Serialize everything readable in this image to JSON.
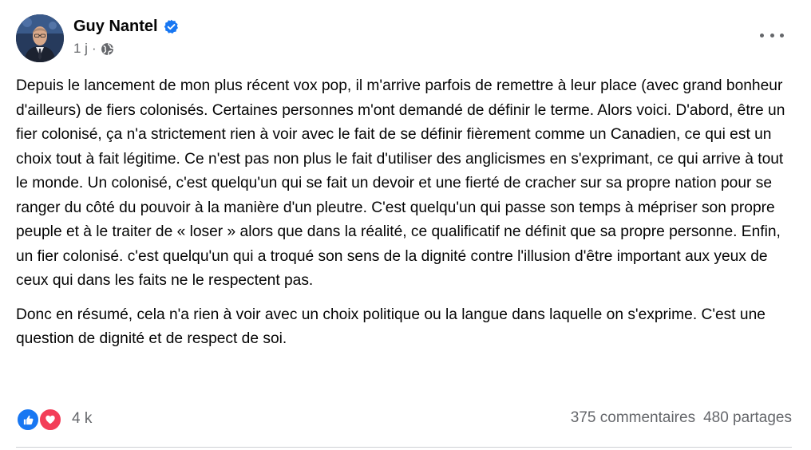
{
  "post": {
    "author": "Guy Nantel",
    "time": "1 j",
    "separator": "·",
    "paragraphs": [
      "Depuis le lancement de mon plus récent vox pop, il m'arrive parfois de remettre à leur place (avec grand bonheur d'ailleurs) de fiers colonisés. Certaines personnes m'ont demandé de définir le terme. Alors voici. D'abord, être un fier colonisé, ça n'a strictement rien à voir avec le fait de se définir fièrement comme un Canadien, ce qui est un choix tout à fait légitime. Ce n'est pas non plus le fait d'utiliser des anglicismes en s'exprimant, ce qui arrive à tout le monde. Un colonisé, c'est quelqu'un qui se fait un devoir et une fierté de cracher sur sa propre nation pour se ranger du côté du pouvoir à la manière d'un pleutre. C'est quelqu'un qui passe son temps à mépriser son propre peuple et à le traiter de « loser » alors que dans la réalité, ce qualificatif ne définit que sa propre personne. Enfin, un fier colonisé. c'est quelqu'un qui a troqué son sens de la dignité contre l'illusion d'être important aux yeux de ceux qui dans les faits ne le respectent pas.",
      "Donc en résumé, cela n'a rien à voir avec un choix politique ou la langue dans laquelle on s'exprime. C'est une question de dignité et de respect de soi."
    ],
    "reactions": {
      "count": "4 k",
      "icons": [
        "like-icon",
        "love-icon"
      ]
    },
    "comments": "375 commentaires",
    "shares": "480 partages"
  },
  "colors": {
    "verified": "#1877f2",
    "like": "#1877f2",
    "love": "#f33e58",
    "secondary_text": "#65676b"
  }
}
